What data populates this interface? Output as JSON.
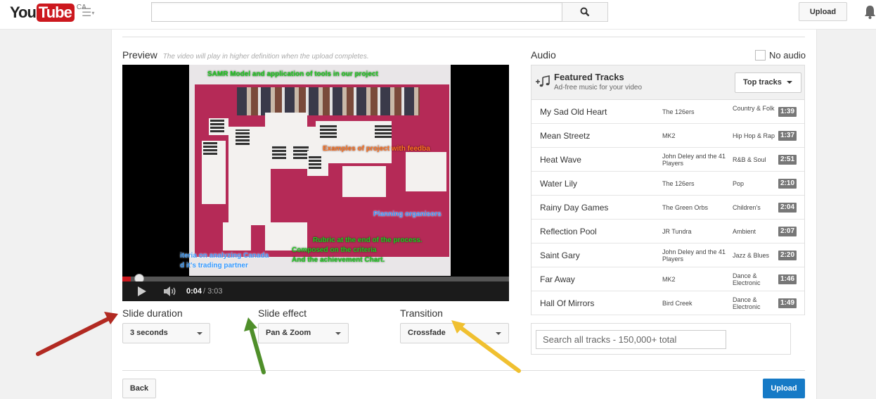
{
  "masthead": {
    "logo_you": "You",
    "logo_tube": "Tube",
    "logo_region": "CA",
    "upload_label": "Upload"
  },
  "preview": {
    "label": "Preview",
    "note": "The video will play in higher definition when the upload completes.",
    "overlay_texts": {
      "samr": "SAMR Model and application of tools in our project",
      "examples": "Examples of project with feedba",
      "planning": "Planning organisors",
      "rubric_1": "Rubric at the end of the process.",
      "rubric_2": "Composed on the criteria",
      "rubric_3": "And the achievement Chart.",
      "criteria_1": "iteria on analyzing Canada",
      "criteria_2": "d it's trading partner"
    },
    "player": {
      "time_current": "0:04",
      "time_total": "/ 3:03",
      "progress_fraction": 0.022
    }
  },
  "options": {
    "slide_duration": {
      "label": "Slide duration",
      "value": "3 seconds"
    },
    "slide_effect": {
      "label": "Slide effect",
      "value": "Pan & Zoom"
    },
    "transition": {
      "label": "Transition",
      "value": "Crossfade"
    }
  },
  "audio": {
    "label": "Audio",
    "no_audio_label": "No audio",
    "featured_title": "Featured Tracks",
    "featured_subtitle": "Ad-free music for your video",
    "sort_label": "Top tracks",
    "tracks": [
      {
        "title": "My Sad Old Heart",
        "artist": "The 126ers",
        "genre": "Country & Folk",
        "duration": "1:39"
      },
      {
        "title": "Mean Streetz",
        "artist": "MK2",
        "genre": "Hip Hop & Rap",
        "duration": "1:37"
      },
      {
        "title": "Heat Wave",
        "artist": "John Deley and the 41 Players",
        "genre": "R&B & Soul",
        "duration": "2:51"
      },
      {
        "title": "Water Lily",
        "artist": "The 126ers",
        "genre": "Pop",
        "duration": "2:10"
      },
      {
        "title": "Rainy Day Games",
        "artist": "The Green Orbs",
        "genre": "Children's",
        "duration": "2:04"
      },
      {
        "title": "Reflection Pool",
        "artist": "JR Tundra",
        "genre": "Ambient",
        "duration": "2:07"
      },
      {
        "title": "Saint Gary",
        "artist": "John Deley and the 41 Players",
        "genre": "Jazz & Blues",
        "duration": "2:20"
      },
      {
        "title": "Far Away",
        "artist": "MK2",
        "genre": "Dance & Electronic",
        "duration": "1:46"
      },
      {
        "title": "Hall Of Mirrors",
        "artist": "Bird Creek",
        "genre": "Dance & Electronic",
        "duration": "1:49"
      }
    ],
    "search_placeholder": "Search all tracks - 150,000+ total"
  },
  "footer": {
    "back_label": "Back",
    "upload_label": "Upload"
  },
  "colors": {
    "brand_red": "#cc181e",
    "primary_blue": "#167ac6",
    "arrow_red": "#b22a22",
    "arrow_green": "#4f8f2a",
    "arrow_yellow": "#f0c030"
  }
}
